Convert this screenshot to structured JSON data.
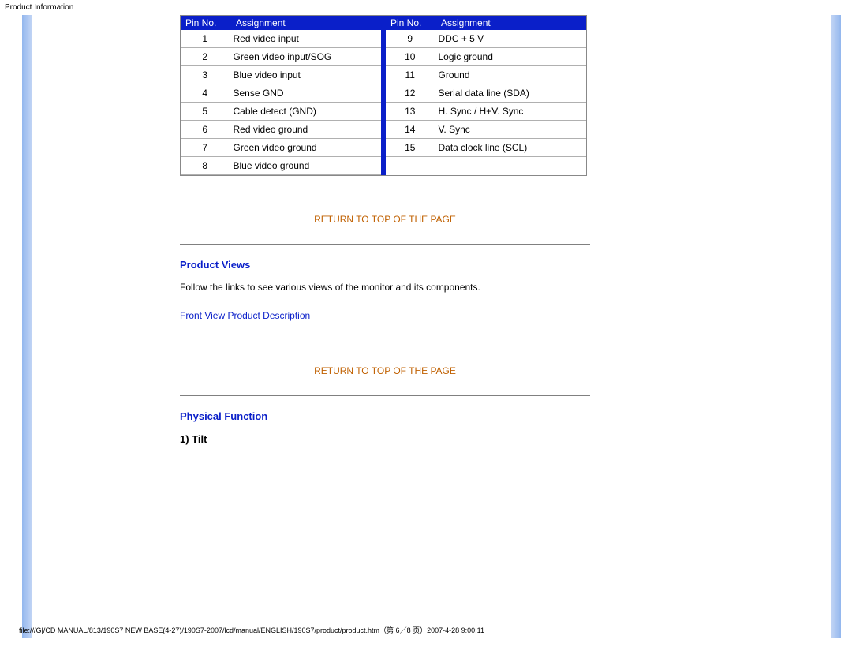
{
  "page": {
    "top_label": "Product Information",
    "footer_path": "file:///G|/CD MANUAL/813/190S7 NEW BASE(4-27)/190S7-2007/lcd/manual/ENGLISH/190S7/product/product.htm（第 6／8 页）2007-4-28 9:00:11"
  },
  "table": {
    "header_pin": "Pin No.",
    "header_assign": "Assignment",
    "left_rows": [
      {
        "pin": "1",
        "assign": "Red video input"
      },
      {
        "pin": "2",
        "assign": "Green video input/SOG"
      },
      {
        "pin": "3",
        "assign": "Blue video input"
      },
      {
        "pin": "4",
        "assign": "Sense GND"
      },
      {
        "pin": "5",
        "assign": "Cable detect (GND)"
      },
      {
        "pin": "6",
        "assign": "Red video ground"
      },
      {
        "pin": "7",
        "assign": "Green video ground"
      },
      {
        "pin": "8",
        "assign": "Blue video ground"
      }
    ],
    "right_rows": [
      {
        "pin": "9",
        "assign": "DDC + 5 V"
      },
      {
        "pin": "10",
        "assign": "Logic ground"
      },
      {
        "pin": "11",
        "assign": "Ground"
      },
      {
        "pin": "12",
        "assign": "Serial data line (SDA)"
      },
      {
        "pin": "13",
        "assign": "H. Sync / H+V. Sync"
      },
      {
        "pin": "14",
        "assign": "V. Sync"
      },
      {
        "pin": "15",
        "assign": "Data clock line (SCL)"
      }
    ]
  },
  "links": {
    "return_top": "RETURN TO TOP OF THE PAGE",
    "front_view": "Front View Product Description"
  },
  "sections": {
    "product_views_heading": "Product Views",
    "product_views_text": "Follow the links to see various views of the monitor and its components.",
    "physical_function_heading": "Physical Function",
    "tilt_label": "1) Tilt"
  }
}
